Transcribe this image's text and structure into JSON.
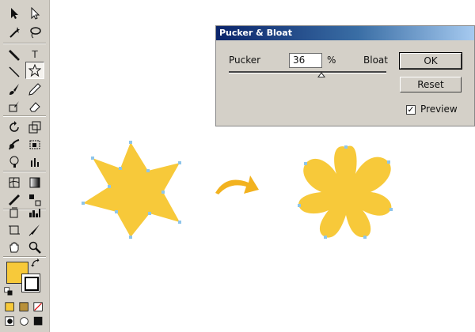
{
  "dialog": {
    "title": "Pucker & Bloat",
    "pucker_label": "Pucker",
    "bloat_label": "Bloat",
    "amount_value": "36",
    "percent_sign": "%",
    "ok_label": "OK",
    "cancel_label": "Reset",
    "preview_label": "Preview",
    "preview_checked": true,
    "slider_value_percent": 36
  },
  "toolbox": {
    "type_tool_label": "T"
  },
  "colors": {
    "fill": "#f7c93a",
    "stroke_anchor": "#7fb8e0",
    "arrow": "#f2b21f",
    "titlebar": "#0a246a"
  }
}
